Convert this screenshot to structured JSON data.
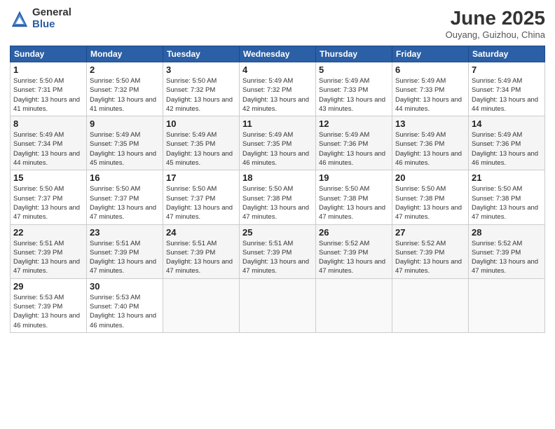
{
  "logo": {
    "general": "General",
    "blue": "Blue"
  },
  "title": "June 2025",
  "subtitle": "Ouyang, Guizhou, China",
  "weekdays": [
    "Sunday",
    "Monday",
    "Tuesday",
    "Wednesday",
    "Thursday",
    "Friday",
    "Saturday"
  ],
  "weeks": [
    [
      {
        "day": "1",
        "sunrise": "Sunrise: 5:50 AM",
        "sunset": "Sunset: 7:31 PM",
        "daylight": "Daylight: 13 hours and 41 minutes."
      },
      {
        "day": "2",
        "sunrise": "Sunrise: 5:50 AM",
        "sunset": "Sunset: 7:32 PM",
        "daylight": "Daylight: 13 hours and 41 minutes."
      },
      {
        "day": "3",
        "sunrise": "Sunrise: 5:50 AM",
        "sunset": "Sunset: 7:32 PM",
        "daylight": "Daylight: 13 hours and 42 minutes."
      },
      {
        "day": "4",
        "sunrise": "Sunrise: 5:49 AM",
        "sunset": "Sunset: 7:32 PM",
        "daylight": "Daylight: 13 hours and 42 minutes."
      },
      {
        "day": "5",
        "sunrise": "Sunrise: 5:49 AM",
        "sunset": "Sunset: 7:33 PM",
        "daylight": "Daylight: 13 hours and 43 minutes."
      },
      {
        "day": "6",
        "sunrise": "Sunrise: 5:49 AM",
        "sunset": "Sunset: 7:33 PM",
        "daylight": "Daylight: 13 hours and 44 minutes."
      },
      {
        "day": "7",
        "sunrise": "Sunrise: 5:49 AM",
        "sunset": "Sunset: 7:34 PM",
        "daylight": "Daylight: 13 hours and 44 minutes."
      }
    ],
    [
      {
        "day": "8",
        "sunrise": "Sunrise: 5:49 AM",
        "sunset": "Sunset: 7:34 PM",
        "daylight": "Daylight: 13 hours and 44 minutes."
      },
      {
        "day": "9",
        "sunrise": "Sunrise: 5:49 AM",
        "sunset": "Sunset: 7:35 PM",
        "daylight": "Daylight: 13 hours and 45 minutes."
      },
      {
        "day": "10",
        "sunrise": "Sunrise: 5:49 AM",
        "sunset": "Sunset: 7:35 PM",
        "daylight": "Daylight: 13 hours and 45 minutes."
      },
      {
        "day": "11",
        "sunrise": "Sunrise: 5:49 AM",
        "sunset": "Sunset: 7:35 PM",
        "daylight": "Daylight: 13 hours and 46 minutes."
      },
      {
        "day": "12",
        "sunrise": "Sunrise: 5:49 AM",
        "sunset": "Sunset: 7:36 PM",
        "daylight": "Daylight: 13 hours and 46 minutes."
      },
      {
        "day": "13",
        "sunrise": "Sunrise: 5:49 AM",
        "sunset": "Sunset: 7:36 PM",
        "daylight": "Daylight: 13 hours and 46 minutes."
      },
      {
        "day": "14",
        "sunrise": "Sunrise: 5:49 AM",
        "sunset": "Sunset: 7:36 PM",
        "daylight": "Daylight: 13 hours and 46 minutes."
      }
    ],
    [
      {
        "day": "15",
        "sunrise": "Sunrise: 5:50 AM",
        "sunset": "Sunset: 7:37 PM",
        "daylight": "Daylight: 13 hours and 47 minutes."
      },
      {
        "day": "16",
        "sunrise": "Sunrise: 5:50 AM",
        "sunset": "Sunset: 7:37 PM",
        "daylight": "Daylight: 13 hours and 47 minutes."
      },
      {
        "day": "17",
        "sunrise": "Sunrise: 5:50 AM",
        "sunset": "Sunset: 7:37 PM",
        "daylight": "Daylight: 13 hours and 47 minutes."
      },
      {
        "day": "18",
        "sunrise": "Sunrise: 5:50 AM",
        "sunset": "Sunset: 7:38 PM",
        "daylight": "Daylight: 13 hours and 47 minutes."
      },
      {
        "day": "19",
        "sunrise": "Sunrise: 5:50 AM",
        "sunset": "Sunset: 7:38 PM",
        "daylight": "Daylight: 13 hours and 47 minutes."
      },
      {
        "day": "20",
        "sunrise": "Sunrise: 5:50 AM",
        "sunset": "Sunset: 7:38 PM",
        "daylight": "Daylight: 13 hours and 47 minutes."
      },
      {
        "day": "21",
        "sunrise": "Sunrise: 5:50 AM",
        "sunset": "Sunset: 7:38 PM",
        "daylight": "Daylight: 13 hours and 47 minutes."
      }
    ],
    [
      {
        "day": "22",
        "sunrise": "Sunrise: 5:51 AM",
        "sunset": "Sunset: 7:39 PM",
        "daylight": "Daylight: 13 hours and 47 minutes."
      },
      {
        "day": "23",
        "sunrise": "Sunrise: 5:51 AM",
        "sunset": "Sunset: 7:39 PM",
        "daylight": "Daylight: 13 hours and 47 minutes."
      },
      {
        "day": "24",
        "sunrise": "Sunrise: 5:51 AM",
        "sunset": "Sunset: 7:39 PM",
        "daylight": "Daylight: 13 hours and 47 minutes."
      },
      {
        "day": "25",
        "sunrise": "Sunrise: 5:51 AM",
        "sunset": "Sunset: 7:39 PM",
        "daylight": "Daylight: 13 hours and 47 minutes."
      },
      {
        "day": "26",
        "sunrise": "Sunrise: 5:52 AM",
        "sunset": "Sunset: 7:39 PM",
        "daylight": "Daylight: 13 hours and 47 minutes."
      },
      {
        "day": "27",
        "sunrise": "Sunrise: 5:52 AM",
        "sunset": "Sunset: 7:39 PM",
        "daylight": "Daylight: 13 hours and 47 minutes."
      },
      {
        "day": "28",
        "sunrise": "Sunrise: 5:52 AM",
        "sunset": "Sunset: 7:39 PM",
        "daylight": "Daylight: 13 hours and 47 minutes."
      }
    ],
    [
      {
        "day": "29",
        "sunrise": "Sunrise: 5:53 AM",
        "sunset": "Sunset: 7:39 PM",
        "daylight": "Daylight: 13 hours and 46 minutes."
      },
      {
        "day": "30",
        "sunrise": "Sunrise: 5:53 AM",
        "sunset": "Sunset: 7:40 PM",
        "daylight": "Daylight: 13 hours and 46 minutes."
      },
      null,
      null,
      null,
      null,
      null
    ]
  ]
}
